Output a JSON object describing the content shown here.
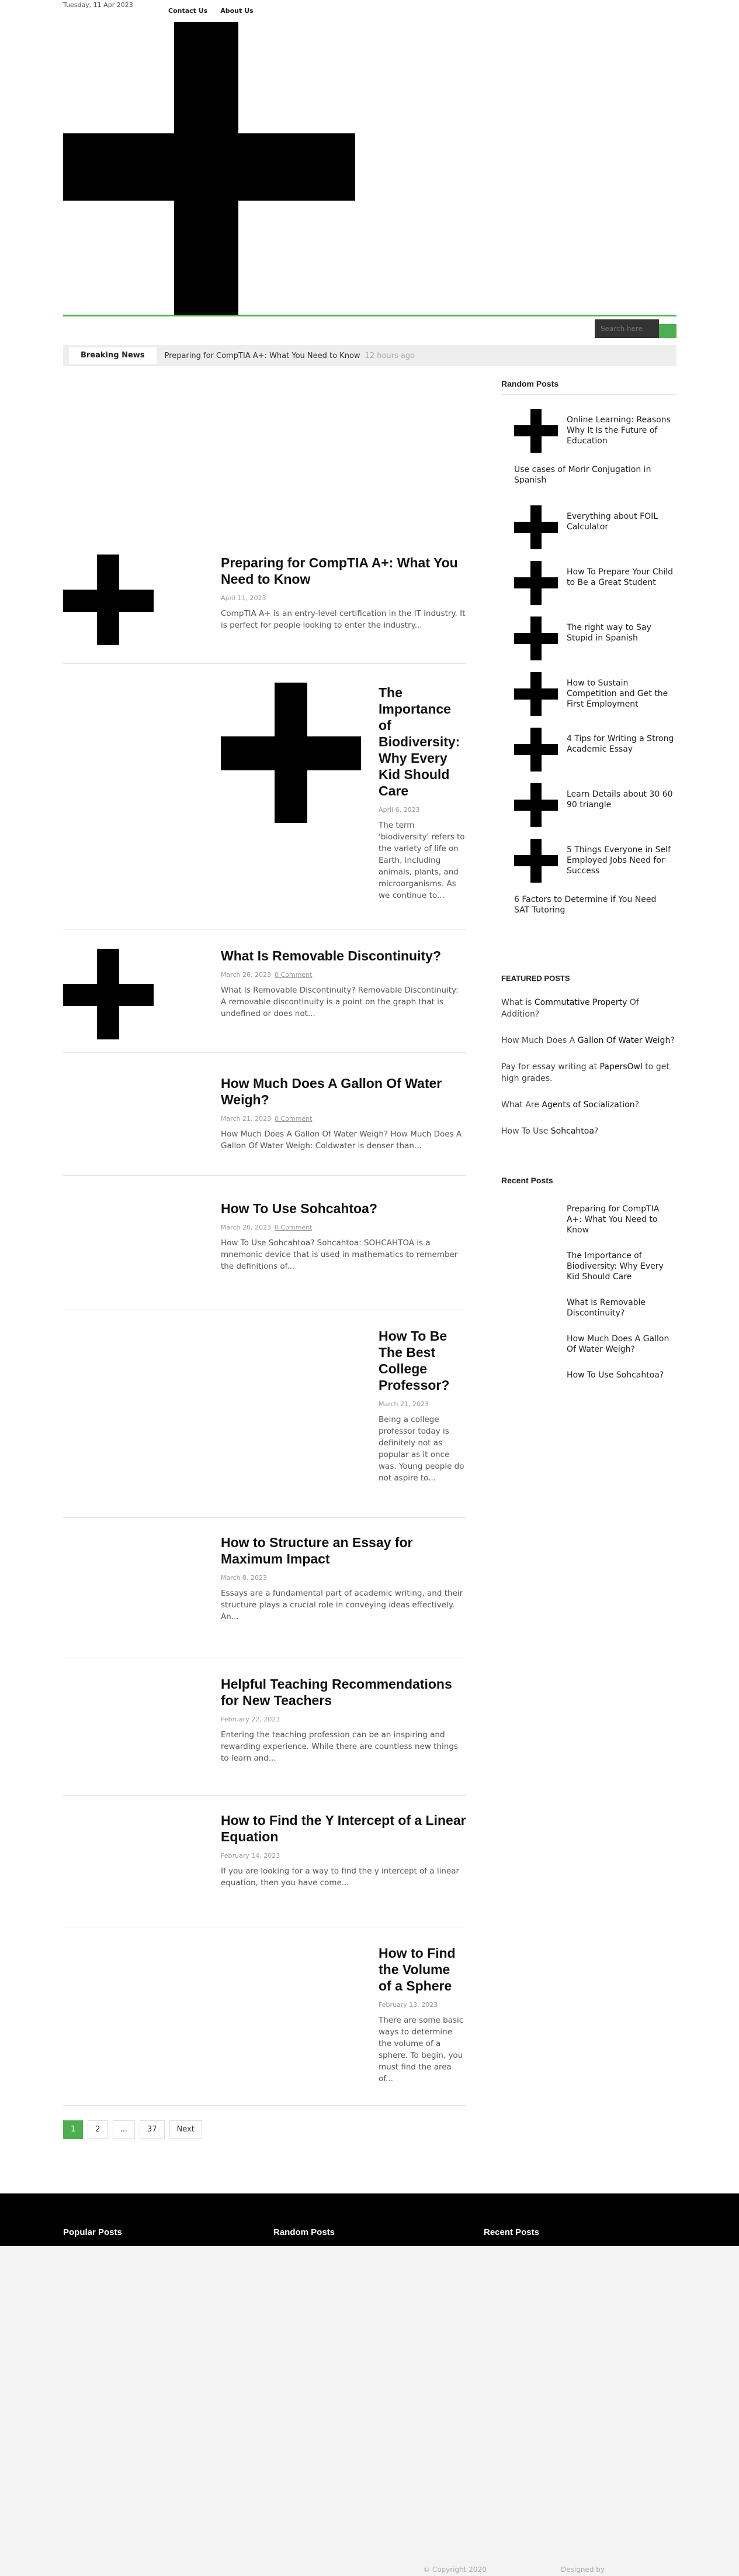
{
  "topbar": {
    "date": "Tuesday, 11 Apr 2023",
    "nav": [
      "Contact Us",
      "About Us"
    ]
  },
  "search": {
    "placeholder": "Search here"
  },
  "breaking": {
    "tag": "Breaking News",
    "headline": "Preparing for CompTIA A+: What You Need to Know",
    "ago": "12 hours ago"
  },
  "posts": [
    {
      "title": "Preparing for CompTIA A+: What You Need to Know",
      "date": "April 11, 2023",
      "comment": "",
      "excerpt": "CompTIA A+ is an entry-level certification in the IT industry. It is perfect for people looking to enter the industry..."
    },
    {
      "title": "The Importance of Biodiversity: Why Every Kid Should Care",
      "date": "April 6, 2023",
      "comment": "",
      "excerpt": "The term 'biodiversity' refers to the variety of life on Earth, including animals, plants, and microorganisms. As we continue to..."
    },
    {
      "title": "What Is Removable Discontinuity?",
      "date": "March 26, 2023",
      "comment": "0 Comment",
      "excerpt": "What Is Removable Discontinuity? Removable Discontinuity: A removable discontinuity is a point on the graph that is undefined or does not..."
    },
    {
      "title": "How Much Does A Gallon Of Water Weigh?",
      "date": "March 21, 2023",
      "comment": "0 Comment",
      "excerpt": "How Much Does A Gallon Of Water Weigh? How Much Does A Gallon Of Water Weigh: Coldwater is denser than..."
    },
    {
      "title": "How To Use Sohcahtoa?",
      "date": "March 20, 2023",
      "comment": "0 Comment",
      "excerpt": "How To Use Sohcahtoa? Sohcahtoa: SOHCAHTOA is a mnemonic device that is used in mathematics to remember the definitions of..."
    },
    {
      "title": "How To Be The Best College Professor?",
      "date": "March 21, 2023",
      "comment": "",
      "excerpt": "Being a college professor today is definitely not as popular as it once was. Young people do not aspire to..."
    },
    {
      "title": "How to Structure an Essay for Maximum Impact",
      "date": "March 8, 2023",
      "comment": "",
      "excerpt": "Essays are a fundamental part of academic writing, and their structure plays a crucial role in conveying ideas effectively. An..."
    },
    {
      "title": "Helpful Teaching Recommendations for New Teachers",
      "date": "February 22, 2023",
      "comment": "",
      "excerpt": "Entering the teaching profession can be an inspiring and rewarding experience. While there are countless new things to learn and..."
    },
    {
      "title": "How to Find the Y Intercept of a Linear Equation",
      "date": "February 14, 2023",
      "comment": "",
      "excerpt": "If you are looking for a way to find the y intercept of a linear equation, then you have come..."
    },
    {
      "title": "How to Find the Volume of a Sphere",
      "date": "February 13, 2023",
      "comment": "",
      "excerpt": "There are some basic ways to determine the volume of a sphere. To begin, you must find the area of..."
    }
  ],
  "sidebar": {
    "random_title": "Random Posts",
    "random": [
      "Online Learning: Reasons Why It Is the Future of Education",
      "Use cases of Morir Conjugation in Spanish",
      "Everything about FOIL Calculator",
      "How To Prepare Your Child to Be a Great Student",
      "The right way to Say Stupid in Spanish",
      "How to Sustain Competition and Get the First Employment",
      "4 Tips for Writing a Strong Academic Essay",
      "Learn Details about 30 60 90 triangle",
      "5 Things Everyone in Self Employed Jobs Need for Success",
      "6 Factors to Determine if You Need SAT Tutoring"
    ],
    "featured_title": "FEATURED POSTS",
    "featured": [
      {
        "pre": "What is ",
        "b": "Commutative Property",
        "post": " Of Addition?"
      },
      {
        "pre": "How Much Does A ",
        "b": "Gallon Of Water Weigh",
        "post": "?"
      },
      {
        "pre": "Pay for essay writing at ",
        "b": "PapersOwl",
        "post": " to get high grades."
      },
      {
        "pre": "What Are ",
        "b": "Agents of Socialization",
        "post": "?"
      },
      {
        "pre": "How To Use ",
        "b": "Sohcahtoa",
        "post": "?"
      }
    ],
    "recent_title": "Recent Posts",
    "recent": [
      "Preparing for CompTIA A+: What You Need to Know",
      "The Importance of Biodiversity: Why Every Kid Should Care",
      "What is Removable Discontinuity?",
      "How Much Does A Gallon Of Water Weigh?",
      "How To Use Sohcahtoa?"
    ]
  },
  "pager": [
    "1",
    "2",
    "...",
    "37",
    "Next"
  ],
  "footer": {
    "popular": "Popular Posts",
    "random": "Random Posts",
    "recent": "Recent Posts",
    "copyright": "© Copyright 2020",
    "designed": "Designed by"
  },
  "colors": {
    "accent": "#4caf50"
  }
}
